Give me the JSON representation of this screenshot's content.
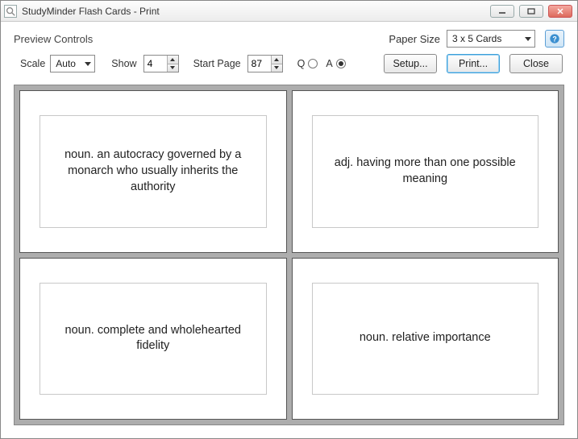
{
  "window": {
    "title": "StudyMinder Flash Cards - Print"
  },
  "controls": {
    "preview_label": "Preview Controls",
    "scale_label": "Scale",
    "scale_value": "Auto",
    "show_label": "Show",
    "show_value": "4",
    "start_page_label": "Start Page",
    "start_page_value": "87",
    "q_label": "Q",
    "a_label": "A",
    "qa_selected": "A",
    "paper_size_label": "Paper Size",
    "paper_size_value": "3 x 5 Cards",
    "setup_label": "Setup...",
    "print_label": "Print...",
    "close_label": "Close"
  },
  "cards": [
    {
      "text": "noun. an autocracy governed by a monarch who usually inherits the authority"
    },
    {
      "text": "adj. having more than one possible meaning"
    },
    {
      "text": "noun. complete and wholehearted fidelity"
    },
    {
      "text": "noun. relative importance"
    }
  ]
}
